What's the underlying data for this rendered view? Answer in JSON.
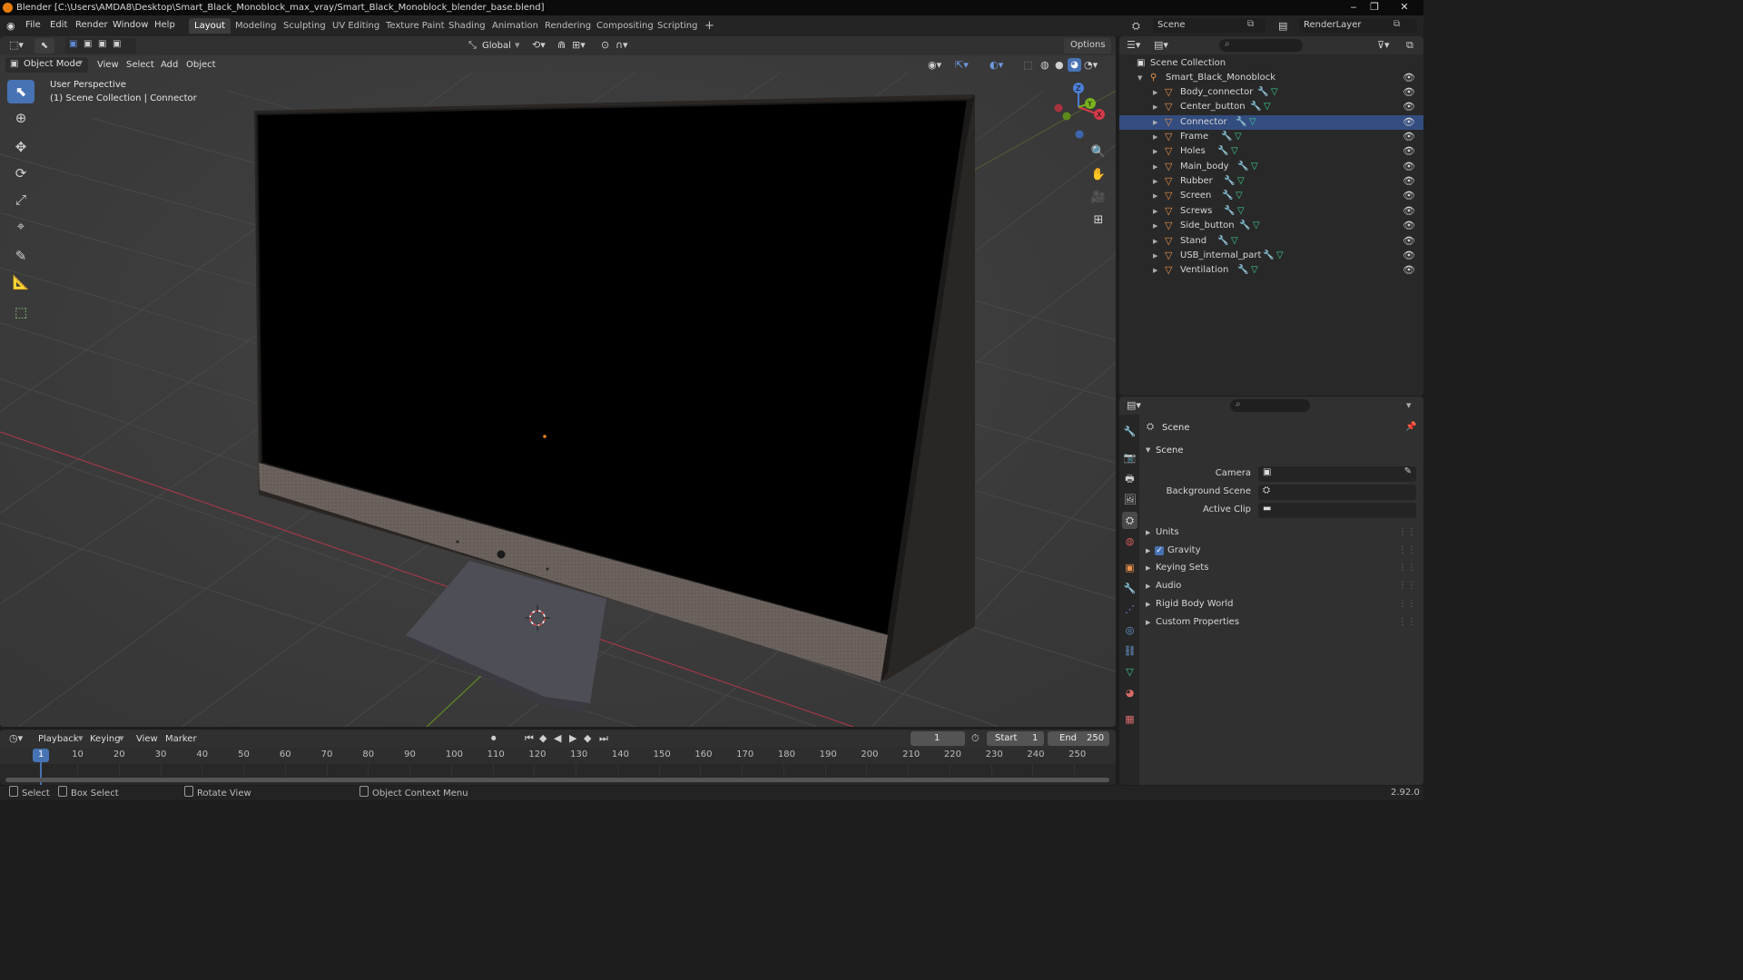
{
  "window": {
    "title": "Blender [C:\\Users\\AMDA8\\Desktop\\Smart_Black_Monoblock_max_vray/Smart_Black_Monoblock_blender_base.blend]",
    "minimize": "‒",
    "restore": "❐",
    "close": "✕"
  },
  "menu": {
    "items": [
      "File",
      "Edit",
      "Render",
      "Window",
      "Help"
    ],
    "workspaces": [
      "Layout",
      "Modeling",
      "Sculpting",
      "UV Editing",
      "Texture Paint",
      "Shading",
      "Animation",
      "Rendering",
      "Compositing",
      "Scripting"
    ],
    "add_workspace": "+",
    "scene_label": "Scene",
    "renderlayer_label": "RenderLayer"
  },
  "viewport": {
    "mode": "Object Mode",
    "menus": [
      "View",
      "Select",
      "Add",
      "Object"
    ],
    "transform_orientation": "Global",
    "options_label": "Options",
    "perspective_label": "User Perspective",
    "collection_label": "(1) Scene Collection | Connector",
    "gizmo_axes": [
      "X",
      "Y",
      "Z"
    ],
    "colors": {
      "background": "#3d3d3d",
      "x_axis": "#d33a4a",
      "y_axis": "#7ab21f",
      "z_axis": "#4b7fd6",
      "tool_active": "#4772b3"
    }
  },
  "toolbar": {
    "tools": [
      "select-box",
      "cursor",
      "move",
      "rotate",
      "scale",
      "transform",
      "annotate",
      "measure",
      "add-cube"
    ]
  },
  "outliner": {
    "root": "Scene Collection",
    "collection": "Smart_Black_Monoblock",
    "objects": [
      "Body_connector",
      "Center_button",
      "Connector",
      "Frame",
      "Holes",
      "Main_body",
      "Rubber",
      "Screen",
      "Screws",
      "Side_button",
      "Stand",
      "USB_internal_part",
      "Ventilation"
    ],
    "active": "Connector"
  },
  "properties": {
    "context": "Scene",
    "panel": "Scene",
    "fields": [
      {
        "label": "Camera",
        "value": ""
      },
      {
        "label": "Background Scene",
        "value": ""
      },
      {
        "label": "Active Clip",
        "value": ""
      }
    ],
    "subpanels": [
      {
        "label": "Units",
        "checkbox": false
      },
      {
        "label": "Gravity",
        "checkbox": true
      },
      {
        "label": "Keying Sets",
        "checkbox": false
      },
      {
        "label": "Audio",
        "checkbox": false
      },
      {
        "label": "Rigid Body World",
        "checkbox": false
      },
      {
        "label": "Custom Properties",
        "checkbox": false
      }
    ]
  },
  "timeline": {
    "menus": [
      "Playback",
      "Keying",
      "View",
      "Marker"
    ],
    "current_frame": "1",
    "start_label": "Start",
    "start_value": "1",
    "end_label": "End",
    "end_value": "250",
    "ticks": [
      "10",
      "20",
      "30",
      "40",
      "50",
      "60",
      "70",
      "80",
      "90",
      "100",
      "110",
      "120",
      "130",
      "140",
      "150",
      "160",
      "170",
      "180",
      "190",
      "200",
      "210",
      "220",
      "230",
      "240",
      "250"
    ],
    "playhead": "1"
  },
  "statusbar": {
    "select": "Select",
    "box_select": "Box Select",
    "rotate_view": "Rotate View",
    "context_menu": "Object Context Menu",
    "version": "2.92.0"
  }
}
